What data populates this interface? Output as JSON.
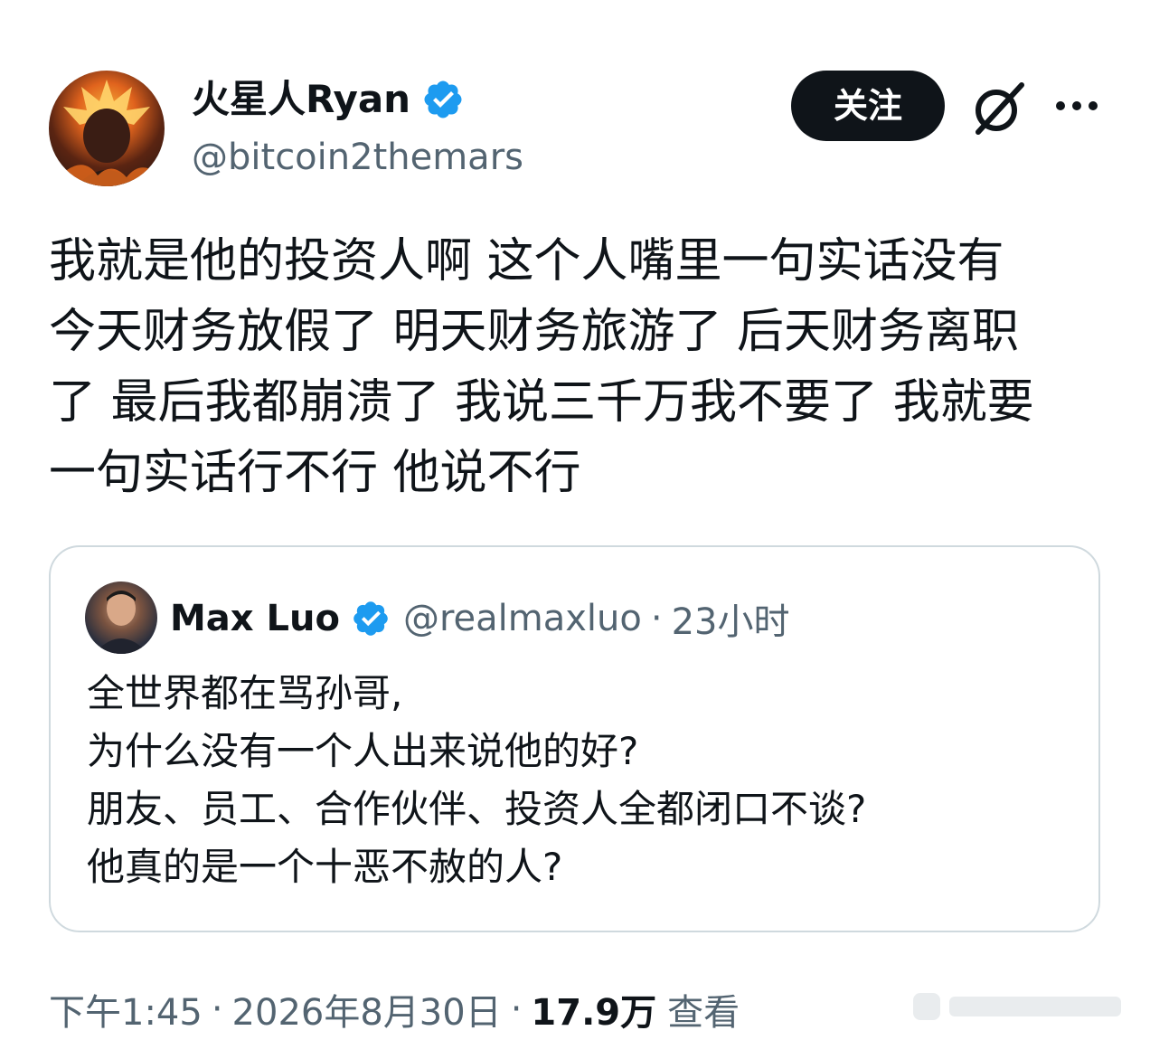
{
  "author": {
    "name": "火星人Ryan",
    "handle": "@bitcoin2themars",
    "avatar_icon": "avatar-fire-character",
    "verified_icon": "verified-badge-icon"
  },
  "actions": {
    "follow_label": "关注",
    "grok_icon": "grok-icon",
    "more_icon": "more-icon"
  },
  "tweet": {
    "lines": [
      "我就是他的投资人啊 这个人嘴里一句实话没有",
      "今天财务放假了 明天财务旅游了 后天财务离职",
      "了 最后我都崩溃了 我说三千万我不要了 我就要",
      "一句实话行不行 他说不行"
    ]
  },
  "quote": {
    "name": "Max Luo",
    "handle": "@realmaxluo",
    "separator": "·",
    "time": "23小时",
    "lines": [
      "全世界都在骂孙哥,",
      "为什么没有一个人出来说他的好?",
      "朋友、员工、合作伙伴、投资人全都闭口不谈?",
      "他真的是一个十恶不赦的人?"
    ]
  },
  "meta": {
    "time": "下午1:45",
    "separator": "·",
    "date": "2026年8月30日",
    "views_count": "17.9万",
    "views_label": "查看"
  },
  "colors": {
    "text_primary": "#0f1419",
    "text_secondary": "#536471",
    "verified_blue": "#1d9bf0",
    "border": "#cfd9de",
    "button_bg": "#0f1419"
  }
}
